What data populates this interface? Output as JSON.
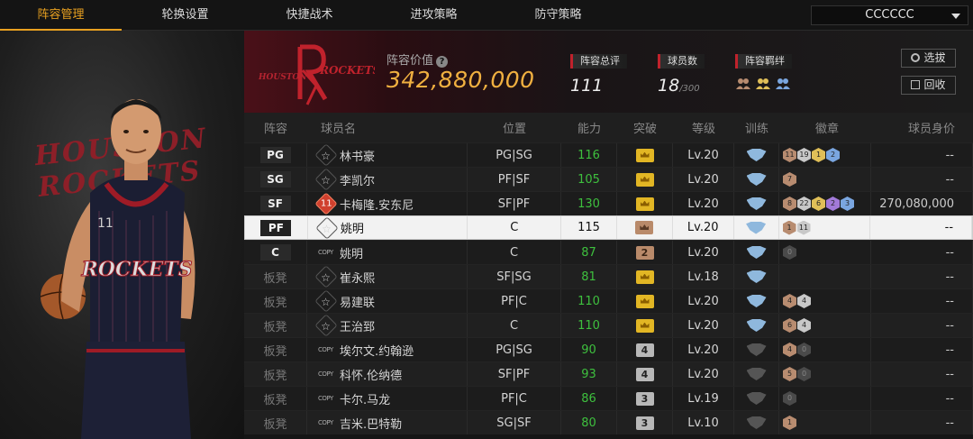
{
  "tabs": [
    "阵容管理",
    "轮换设置",
    "快捷战术",
    "进攻策略",
    "防守策略"
  ],
  "active_tab": 0,
  "team_select": {
    "value": "CCCCCC"
  },
  "left_panel": {
    "bg_text": "HOUSTON ROCKETS"
  },
  "header": {
    "logo_text": "ROCKETS",
    "logo_sub": "HOUSTON",
    "lineup_value_label": "阵容价值",
    "lineup_value": "342,880,000",
    "overall_label": "阵容总评",
    "overall": "111",
    "players_label": "球员数",
    "players": "18",
    "players_max": "/300",
    "chemistry_label": "阵容羁绊",
    "select_button": "选拔",
    "recycle_button": "回收"
  },
  "columns": [
    "阵容",
    "球员名",
    "位置",
    "能力",
    "突破",
    "等级",
    "训练",
    "徽章",
    "球员身价"
  ],
  "rows": [
    {
      "slot": "PG",
      "bench": false,
      "icon": "star",
      "name": "林书豪",
      "position": "PG|SG",
      "ability": "116",
      "break": "crown",
      "break_label": "",
      "level": "Lv.20",
      "train": "shield",
      "badges": [
        [
          "b",
          "11"
        ],
        [
          "s",
          "19"
        ],
        [
          "g",
          "1"
        ],
        [
          "bl",
          "2"
        ]
      ],
      "value": "--",
      "selected": false
    },
    {
      "slot": "SG",
      "bench": false,
      "icon": "star",
      "name": "李凯尔",
      "position": "PF|SF",
      "ability": "105",
      "break": "crown",
      "break_label": "",
      "level": "Lv.20",
      "train": "shield",
      "badges": [
        [
          "b",
          "7"
        ]
      ],
      "value": "--",
      "selected": false
    },
    {
      "slot": "SF",
      "bench": false,
      "icon": "num11",
      "name": "卡梅隆.安东尼",
      "position": "SF|PF",
      "ability": "130",
      "break": "crown",
      "break_label": "",
      "level": "Lv.20",
      "train": "shield",
      "badges": [
        [
          "b",
          "8"
        ],
        [
          "s",
          "22"
        ],
        [
          "g",
          "6"
        ],
        [
          "p",
          "2"
        ],
        [
          "bl",
          "3"
        ]
      ],
      "value": "270,080,000",
      "selected": false
    },
    {
      "slot": "PF",
      "bench": false,
      "icon": "star",
      "name": "姚明",
      "position": "C",
      "ability": "115",
      "break": "crownb",
      "break_label": "",
      "level": "Lv.20",
      "train": "shield",
      "badges": [
        [
          "b",
          "1"
        ],
        [
          "s",
          "11"
        ]
      ],
      "value": "--",
      "selected": true
    },
    {
      "slot": "C",
      "bench": false,
      "icon": "copy",
      "name": "姚明",
      "position": "C",
      "ability": "87",
      "break": "brown",
      "break_label": "2",
      "level": "Lv.20",
      "train": "shield",
      "badges": [
        [
          "d",
          "0"
        ]
      ],
      "value": "--",
      "selected": false
    },
    {
      "slot": "板凳",
      "bench": true,
      "icon": "star",
      "name": "崔永熙",
      "position": "SF|SG",
      "ability": "81",
      "break": "crown",
      "break_label": "",
      "level": "Lv.18",
      "train": "shield",
      "badges": [],
      "value": "--",
      "selected": false
    },
    {
      "slot": "板凳",
      "bench": true,
      "icon": "star",
      "name": "易建联",
      "position": "PF|C",
      "ability": "110",
      "break": "crown",
      "break_label": "",
      "level": "Lv.20",
      "train": "shield",
      "badges": [
        [
          "b",
          "4"
        ],
        [
          "s",
          "4"
        ]
      ],
      "value": "--",
      "selected": false
    },
    {
      "slot": "板凳",
      "bench": true,
      "icon": "star",
      "name": "王治郅",
      "position": "C",
      "ability": "110",
      "break": "crown",
      "break_label": "",
      "level": "Lv.20",
      "train": "shield",
      "badges": [
        [
          "b",
          "6"
        ],
        [
          "s",
          "4"
        ]
      ],
      "value": "--",
      "selected": false
    },
    {
      "slot": "板凳",
      "bench": true,
      "icon": "copy",
      "name": "埃尔文.约翰逊",
      "position": "PG|SG",
      "ability": "90",
      "break": "gray",
      "break_label": "4",
      "level": "Lv.20",
      "train": "dim",
      "badges": [
        [
          "b",
          "4"
        ],
        [
          "d",
          "0"
        ]
      ],
      "value": "--",
      "selected": false
    },
    {
      "slot": "板凳",
      "bench": true,
      "icon": "copy",
      "name": "科怀.伦纳德",
      "position": "SF|PF",
      "ability": "93",
      "break": "gray",
      "break_label": "4",
      "level": "Lv.20",
      "train": "dim",
      "badges": [
        [
          "b",
          "5"
        ],
        [
          "d",
          "0"
        ]
      ],
      "value": "--",
      "selected": false
    },
    {
      "slot": "板凳",
      "bench": true,
      "icon": "copy",
      "name": "卡尔.马龙",
      "position": "PF|C",
      "ability": "86",
      "break": "gray",
      "break_label": "3",
      "level": "Lv.19",
      "train": "dim",
      "badges": [
        [
          "d",
          "0"
        ]
      ],
      "value": "--",
      "selected": false
    },
    {
      "slot": "板凳",
      "bench": true,
      "icon": "copy",
      "name": "吉米.巴特勒",
      "position": "SG|SF",
      "ability": "80",
      "break": "gray",
      "break_label": "3",
      "level": "Lv.10",
      "train": "dim",
      "badges": [
        [
          "b",
          "1"
        ]
      ],
      "value": "--",
      "selected": false
    }
  ],
  "colors": {
    "accent": "#e8a020",
    "value_gold": "#f0b040",
    "ability_green": "#3ec03e",
    "rockets_red": "#c0222c"
  }
}
